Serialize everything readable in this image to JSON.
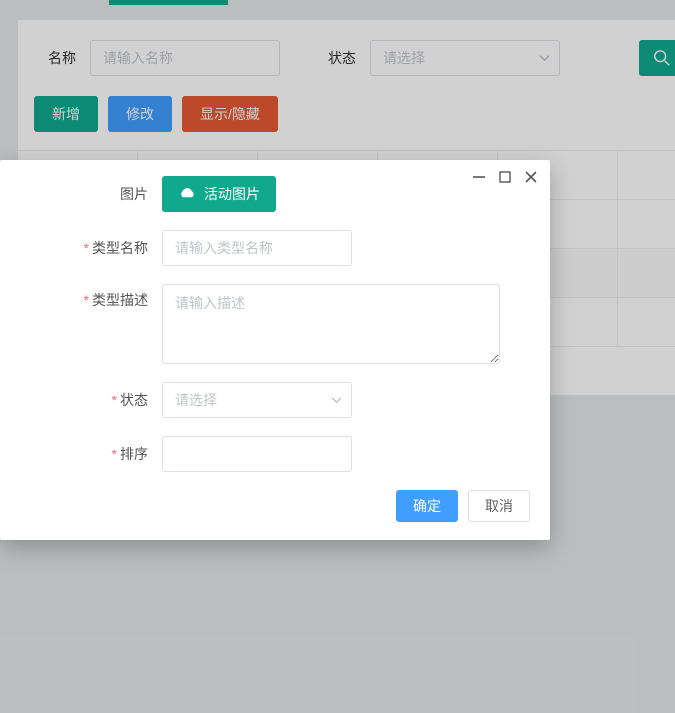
{
  "filter": {
    "name_label": "名称",
    "name_placeholder": "请输入名称",
    "status_label": "状态",
    "status_placeholder": "请选择"
  },
  "toolbar": {
    "add": "新增",
    "edit": "修改",
    "toggle": "显示/隐藏"
  },
  "modal": {
    "image_label": "图片",
    "upload_label": "活动图片",
    "type_name_label": "类型名称",
    "type_name_placeholder": "请输入类型名称",
    "type_desc_label": "类型描述",
    "type_desc_placeholder": "请输入描述",
    "status_label": "状态",
    "status_placeholder": "请选择",
    "sort_label": "排序",
    "ok": "确定",
    "cancel": "取消"
  }
}
